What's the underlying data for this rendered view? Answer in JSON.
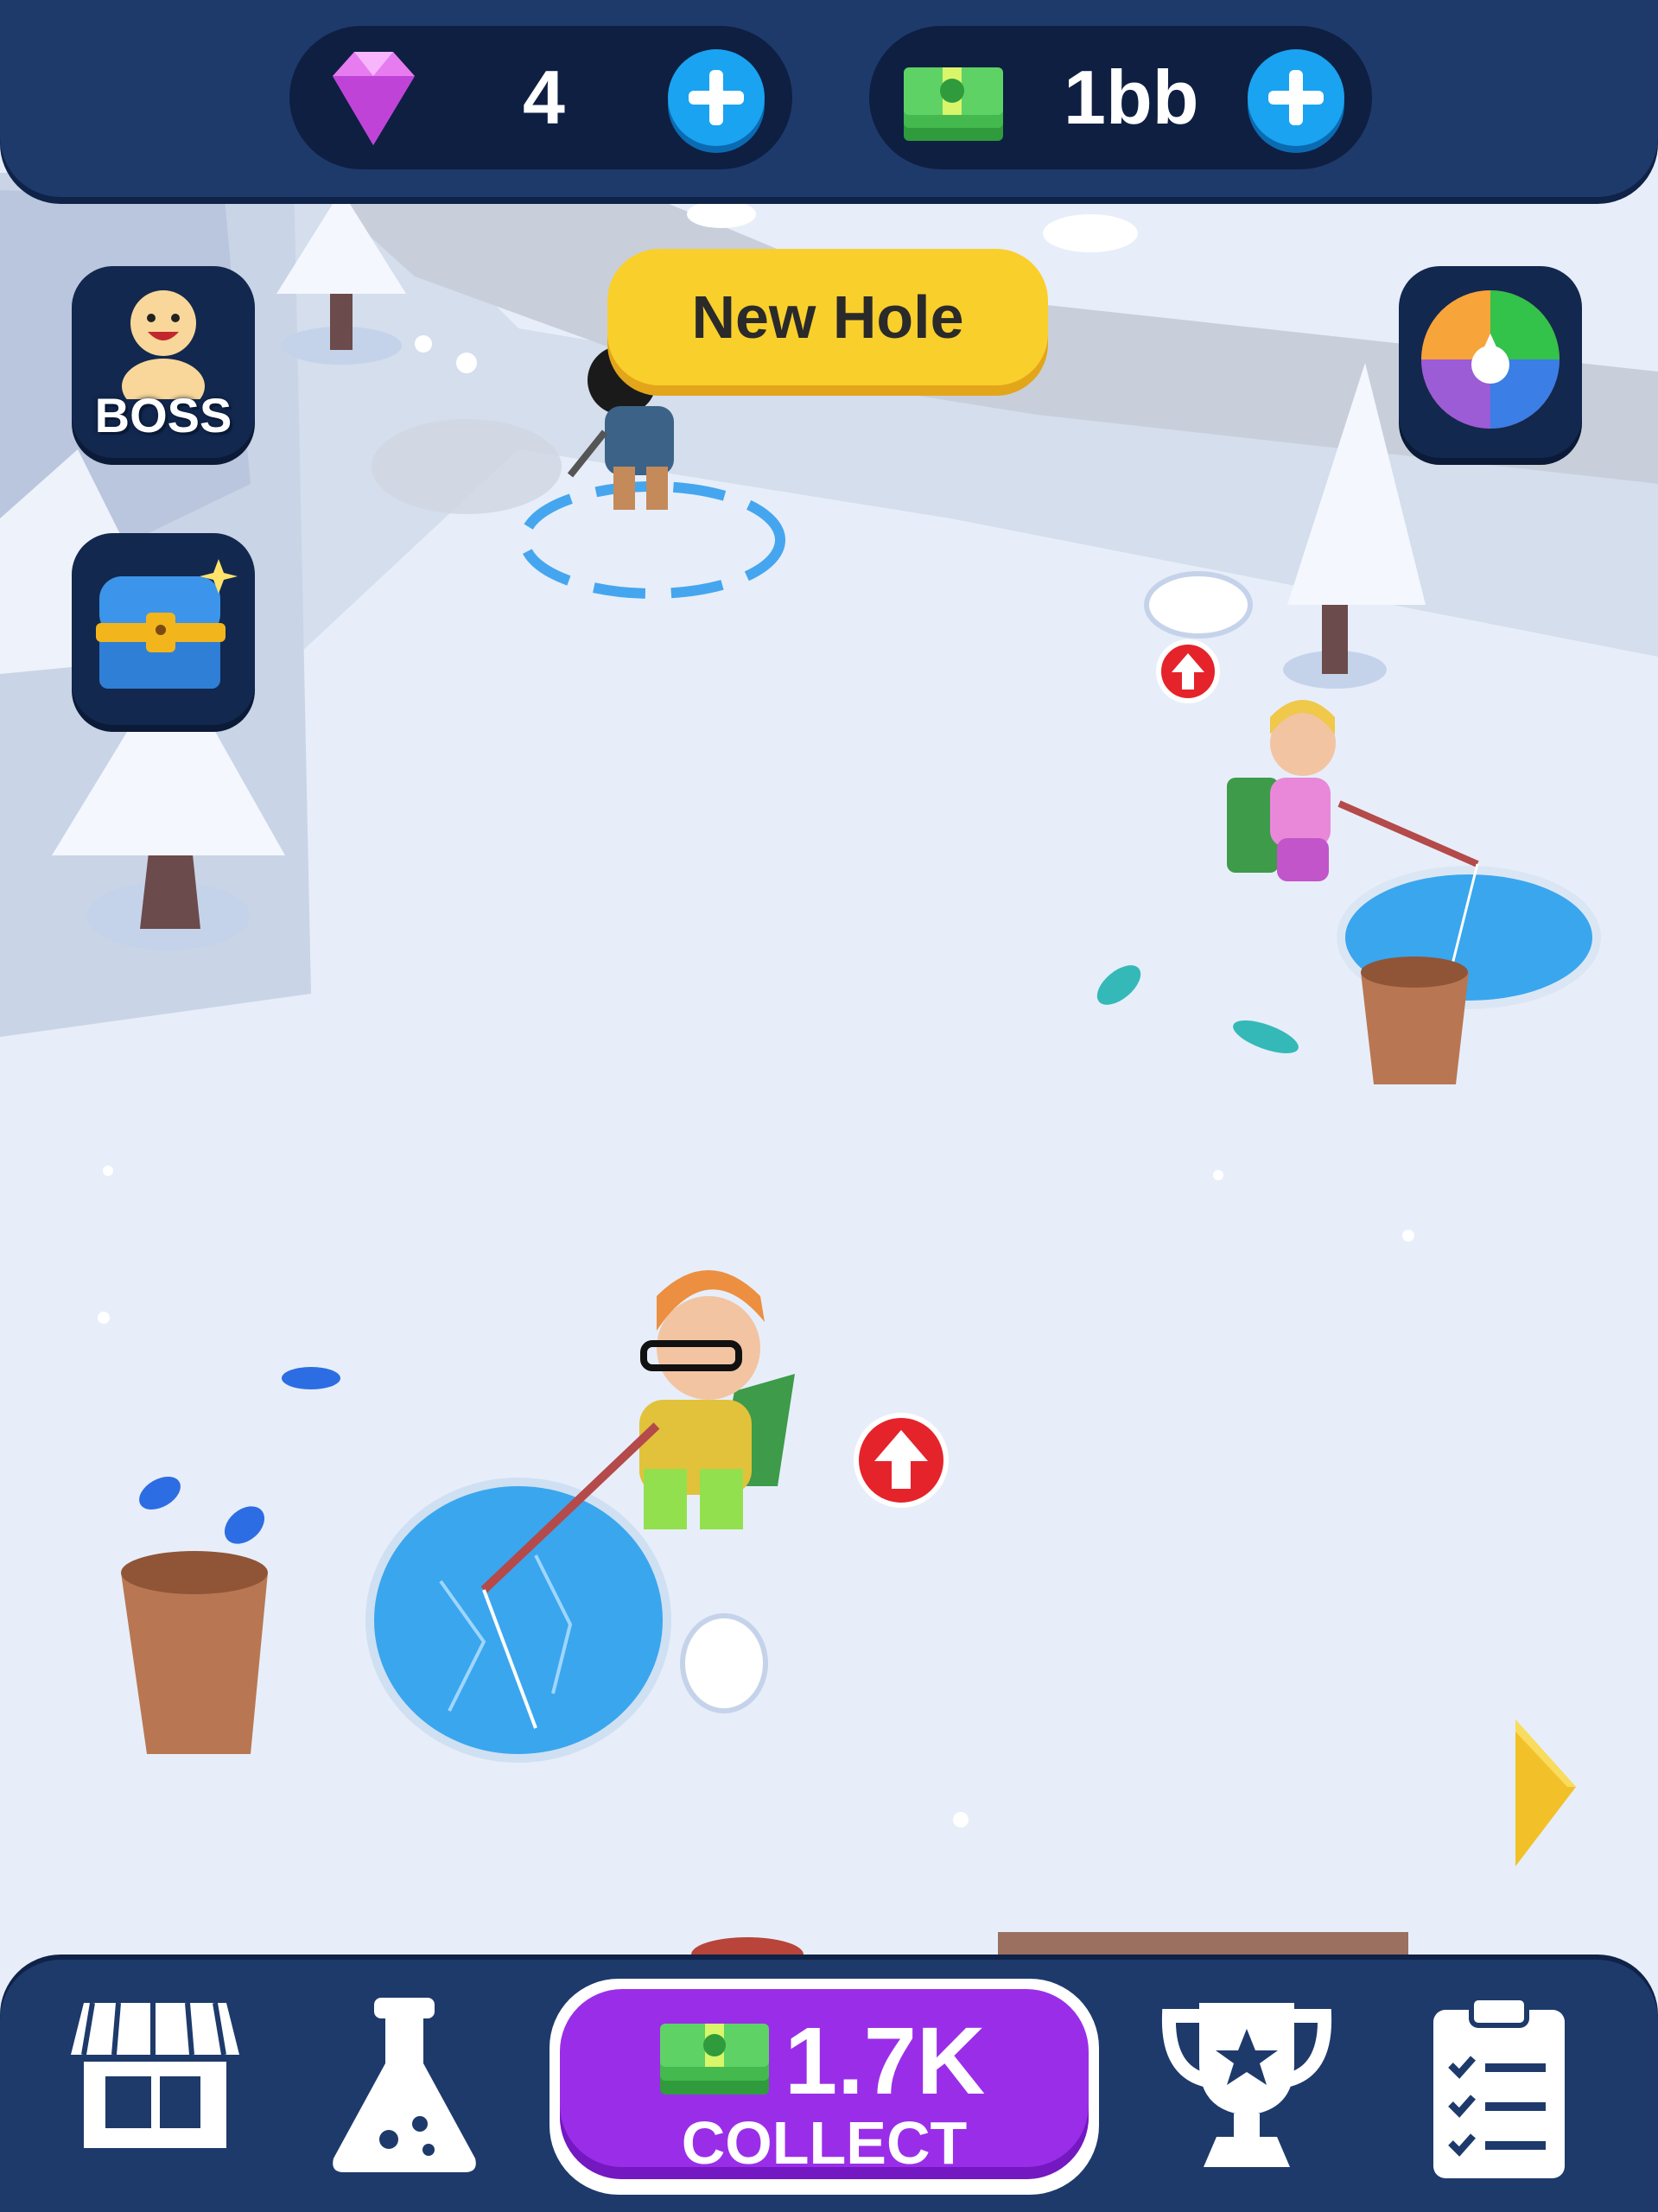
{
  "hud": {
    "gems_value": "4",
    "cash_value": "1bb"
  },
  "side_buttons": {
    "boss_label": "BOSS"
  },
  "new_hole_label": "New Hole",
  "bottom": {
    "collect_amount": "1.7K",
    "collect_label": "COLLECT"
  },
  "icons": {
    "gem": "gem-icon",
    "cash": "cash-icon",
    "boss": "boss-icon",
    "chest": "treasure-chest-icon",
    "wheel": "spin-wheel-icon",
    "shop": "shop-icon",
    "lab": "flask-icon",
    "trophy": "trophy-icon",
    "tasks": "clipboard-icon",
    "upgrade": "upgrade-arrow-icon",
    "next": "next-arrow-icon"
  },
  "colors": {
    "bar": "#1e3a6b",
    "collect": "#9a2ee8",
    "new_hole": "#f9cf2c",
    "ice": "#3aa6ee"
  }
}
